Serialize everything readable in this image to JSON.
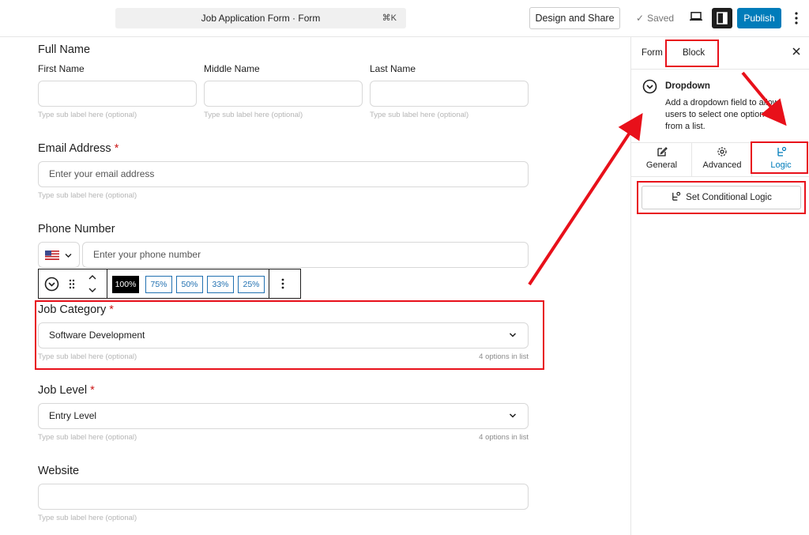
{
  "topbar": {
    "command_title": "Job Application Form · Form",
    "command_shortcut": "⌘K",
    "design_share_label": "Design and Share",
    "saved_label": "Saved",
    "publish_label": "Publish"
  },
  "form": {
    "full_name": {
      "title": "Full Name",
      "first_label": "First Name",
      "middle_label": "Middle Name",
      "last_label": "Last Name",
      "sub_hint": "Type sub label here (optional)"
    },
    "email": {
      "title": "Email Address",
      "required_mark": "*",
      "placeholder": "Enter your email address",
      "sub_hint": "Type sub label here (optional)"
    },
    "phone": {
      "title": "Phone Number",
      "placeholder": "Enter your phone number"
    },
    "job_category": {
      "title": "Job Category",
      "required_mark": "*",
      "value": "Software Development",
      "sub_hint": "Type sub label here (optional)",
      "options_count": "4 options in list"
    },
    "job_level": {
      "title": "Job Level",
      "required_mark": "*",
      "value": "Entry Level",
      "sub_hint": "Type sub label here (optional)",
      "options_count": "4 options in list"
    },
    "website": {
      "title": "Website",
      "sub_hint": "Type sub label here (optional)"
    }
  },
  "block_toolbar": {
    "widths": [
      "100%",
      "75%",
      "50%",
      "33%",
      "25%"
    ],
    "active_width": "100%"
  },
  "sidebar": {
    "tabs": [
      "Form",
      "Block"
    ],
    "active_tab": "Block",
    "block_name": "Dropdown",
    "block_description": "Add a dropdown field to allow users to select one option from a list.",
    "settings_tabs": [
      "General",
      "Advanced",
      "Logic"
    ],
    "active_settings_tab": "Logic",
    "conditional_logic_label": "Set Conditional Logic"
  },
  "colors": {
    "accent": "#007cba",
    "annotation": "#e8101a",
    "required": "#cc1818"
  },
  "icons": {
    "flag": "us-flag-icon",
    "dropdown": "chevron-circle-icon",
    "logic": "logic-branch-icon"
  }
}
